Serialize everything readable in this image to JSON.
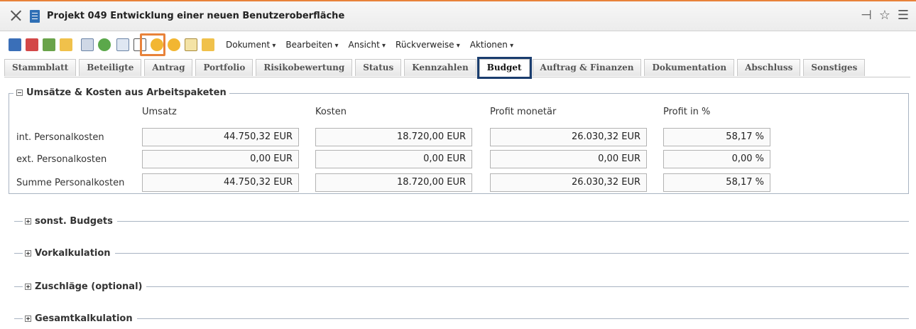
{
  "window": {
    "title": "Projekt 049 Entwicklung einer neuen Benutzeroberfläche",
    "right_icons": [
      "pin-icon",
      "star-icon",
      "menu-icon"
    ]
  },
  "toolbar": {
    "icons": [
      "save-icon",
      "delete-icon",
      "download-icon",
      "folder-icon",
      "table-icon",
      "refresh-check-icon",
      "report-icon",
      "edit-icon",
      "coins-add-icon",
      "coins-icon",
      "checklist-icon",
      "export-folder-icon"
    ],
    "menus": [
      "Dokument",
      "Bearbeiten",
      "Ansicht",
      "Rückverweise",
      "Aktionen"
    ]
  },
  "tabs": [
    {
      "label": "Stammblatt"
    },
    {
      "label": "Beteiligte"
    },
    {
      "label": "Antrag"
    },
    {
      "label": "Portfolio"
    },
    {
      "label": "Risikobewertung"
    },
    {
      "label": "Status"
    },
    {
      "label": "Kennzahlen"
    },
    {
      "label": "Budget",
      "active": true
    },
    {
      "label": "Auftrag & Finanzen"
    },
    {
      "label": "Dokumentation"
    },
    {
      "label": "Abschluss"
    },
    {
      "label": "Sonstiges"
    }
  ],
  "umsaetze": {
    "title": "Umsätze & Kosten aus Arbeitspaketen",
    "columns": [
      "Umsatz",
      "Kosten",
      "Profit monetär",
      "Profit in %"
    ],
    "rows": [
      {
        "label": "int. Personalkosten",
        "values": [
          "44.750,32 EUR",
          "18.720,00 EUR",
          "26.030,32 EUR",
          "58,17 %"
        ]
      },
      {
        "label": "ext. Personalkosten",
        "values": [
          "0,00 EUR",
          "0,00 EUR",
          "0,00 EUR",
          "0,00 %"
        ]
      },
      {
        "label": "Summe Personalkosten",
        "values": [
          "44.750,32 EUR",
          "18.720,00 EUR",
          "26.030,32 EUR",
          "58,17 %"
        ]
      }
    ]
  },
  "sections": [
    {
      "label": "sonst. Budgets"
    },
    {
      "label": "Vorkalkulation"
    },
    {
      "label": "Zuschläge (optional)"
    },
    {
      "label": "Gesamtkalkulation"
    }
  ],
  "colors": {
    "accent": "#e8823a",
    "active_tab_outline": "#1a3d6e",
    "fieldset_border": "#a9b4c2"
  }
}
